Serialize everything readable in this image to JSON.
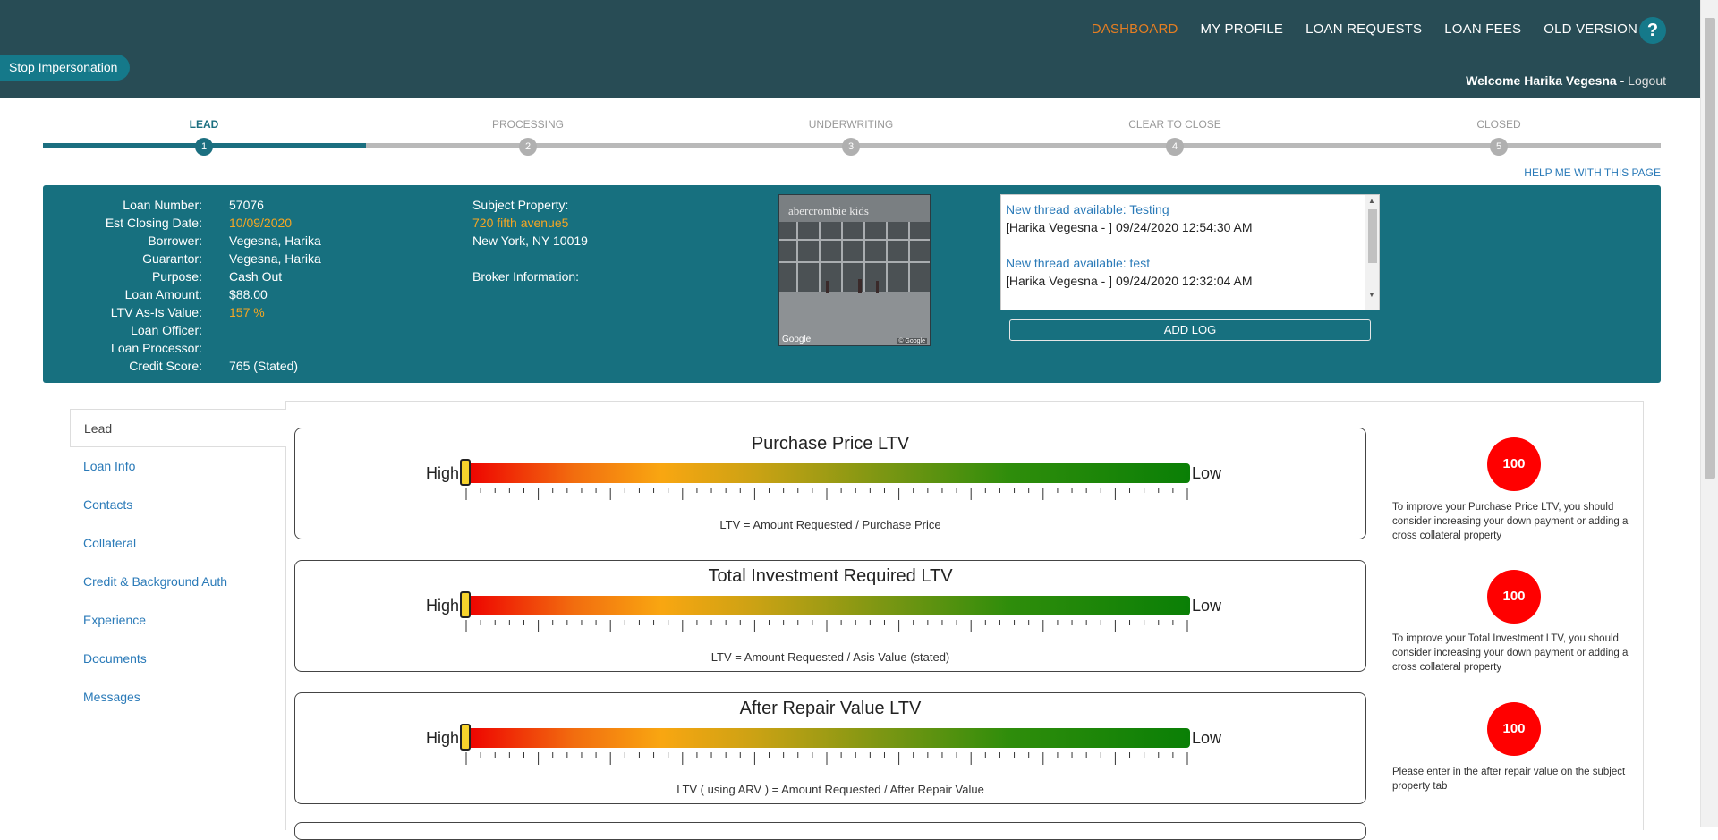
{
  "nav": {
    "items": [
      "DASHBOARD",
      "MY PROFILE",
      "LOAN REQUESTS",
      "LOAN FEES",
      "OLD VERSION"
    ],
    "help_label": "?",
    "accent": "#e67e22"
  },
  "impersonation": {
    "stop_label": "Stop Impersonation"
  },
  "user": {
    "welcome": "Welcome Harika Vegesna",
    "separator": " - ",
    "logout": "Logout"
  },
  "steps": [
    {
      "label": "LEAD",
      "num": "1"
    },
    {
      "label": "PROCESSING",
      "num": "2"
    },
    {
      "label": "UNDERWRITING",
      "num": "3"
    },
    {
      "label": "CLEAR TO CLOSE",
      "num": "4"
    },
    {
      "label": "CLOSED",
      "num": "5"
    }
  ],
  "help_page": "HELP ME WITH THIS PAGE",
  "loan": {
    "fields": [
      {
        "key": "Loan Number:",
        "value": "57076"
      },
      {
        "key": "Est Closing Date:",
        "value": "10/09/2020"
      },
      {
        "key": "Borrower:",
        "value": "Vegesna, Harika"
      },
      {
        "key": "Guarantor:",
        "value": "Vegesna, Harika"
      },
      {
        "key": "Purpose:",
        "value": "Cash Out"
      },
      {
        "key": "Loan Amount:",
        "value": "$88.00"
      },
      {
        "key": "LTV As-Is Value:",
        "value": "157 %"
      },
      {
        "key": "Loan Officer:",
        "value": ""
      },
      {
        "key": "Loan Processor:",
        "value": ""
      },
      {
        "key": "Credit Score:",
        "value": "765 (Stated)"
      }
    ],
    "subject_label": "Subject Property:",
    "address_line1": "720 fifth avenue5",
    "address_line2": "New York, NY 10019",
    "broker_label": "Broker Information:",
    "photo_sign": "abercrombie kids",
    "photo_google": "Google",
    "photo_copyright": "© Google"
  },
  "log": {
    "entries": [
      {
        "title": "New thread available: Testing",
        "body": "[Harika Vegesna - ] 09/24/2020 12:54:30 AM"
      },
      {
        "title": "New thread available: test",
        "body": "[Harika Vegesna - ] 09/24/2020 12:32:04 AM"
      }
    ],
    "add_label": "ADD LOG"
  },
  "tabs": [
    "Lead",
    "Loan Info",
    "Contacts",
    "Collateral",
    "Credit & Background Auth",
    "Experience",
    "Documents",
    "Messages"
  ],
  "ltv_cards": [
    {
      "title": "Purchase Price LTV",
      "high": "High",
      "low": "Low",
      "formula": "LTV = Amount Requested / Purchase Price",
      "score": "100",
      "tip": "To improve your Purchase Price LTV, you should consider increasing your down payment or adding a cross collateral property"
    },
    {
      "title": "Total Investment Required LTV",
      "high": "High",
      "low": "Low",
      "formula": "LTV = Amount Requested / Asis Value (stated)",
      "score": "100",
      "tip": "To improve your Total Investment LTV, you should consider increasing your down payment or adding a cross collateral property"
    },
    {
      "title": "After Repair Value LTV",
      "high": "High",
      "low": "Low",
      "formula": "LTV ( using ARV ) = Amount Requested / After Repair Value",
      "score": "100",
      "tip": "Please enter in the after repair value on the subject property tab"
    }
  ]
}
